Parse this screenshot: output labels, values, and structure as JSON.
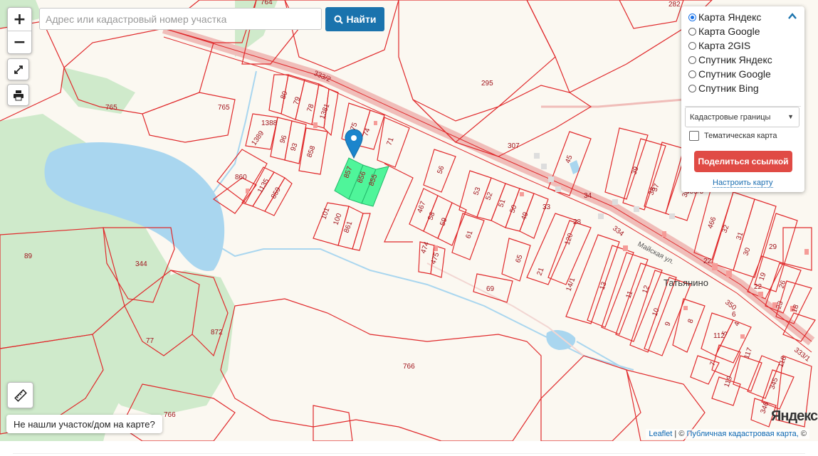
{
  "search": {
    "placeholder": "Адрес или кадастровый номер участка",
    "button_label": "Найти"
  },
  "zoom": {
    "in_label": "+",
    "out_label": "−"
  },
  "tools": [
    "fullscreen-icon",
    "print-icon",
    "ruler-icon"
  ],
  "layers": {
    "base_layers": [
      {
        "label": "Карта Яндекс",
        "selected": true
      },
      {
        "label": "Карта Google",
        "selected": false
      },
      {
        "label": "Карта 2GIS",
        "selected": false
      },
      {
        "label": "Спутник Яндекс",
        "selected": false
      },
      {
        "label": "Спутник Google",
        "selected": false
      },
      {
        "label": "Спутник Bing",
        "selected": false
      }
    ],
    "overlay_select": "Кадастровые границы",
    "thematic_label": "Тематическая карта",
    "thematic_checked": false,
    "share_button": "Поделиться ссылкой",
    "configure_link": "Настроить карту"
  },
  "not_found_button": "Не нашли участок/дом на карте?",
  "attribution": {
    "leaflet": "Leaflet",
    "separator": "| ©",
    "pkk": "Публичная кадастровая карта,",
    "copyright": "©"
  },
  "yandex_logo": "Яндекс",
  "colors": {
    "parcel_border": "#e0292b",
    "selected_fill": "#4ff59a",
    "water": "#a9d6ef",
    "forest": "#cfeacb",
    "road": "#f4a3a0",
    "button_blue": "#1a73ad",
    "share_red": "#e04b45",
    "marker_blue": "#1b85cc"
  },
  "map_labels": {
    "parcels": [
      "764",
      "282",
      "765",
      "765",
      "80",
      "79",
      "78",
      "1381",
      "1388",
      "1389",
      "96",
      "93",
      "858",
      "75",
      "74",
      "71",
      "860",
      "1135",
      "859",
      "857",
      "856",
      "855",
      "101",
      "100",
      "861",
      "295",
      "307",
      "56",
      "53",
      "52",
      "51",
      "50",
      "49",
      "467",
      "58",
      "59",
      "61",
      "474",
      "475",
      "65",
      "69",
      "45",
      "39",
      "38",
      "37",
      "35",
      "34",
      "33",
      "28",
      "120",
      "21",
      "14/1",
      "13",
      "11",
      "12",
      "10",
      "9",
      "8",
      "112",
      "5",
      "4",
      "6",
      "7",
      "117",
      "119",
      "118",
      "345",
      "346",
      "466",
      "32",
      "31",
      "30",
      "29",
      "26",
      "22",
      "23",
      "22",
      "19",
      "18",
      "89",
      "344",
      "872",
      "77",
      "766",
      "766",
      "334",
      "350",
      "333/1",
      "333/2",
      "333/3",
      "2563/3",
      "36"
    ],
    "streets": [
      "Майская ул."
    ],
    "places": [
      "Татьянино"
    ]
  }
}
